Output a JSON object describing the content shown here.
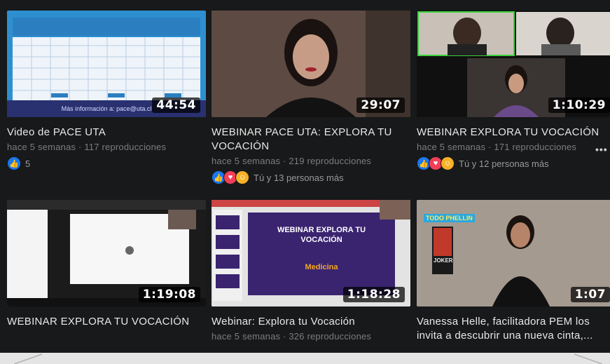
{
  "videos": [
    {
      "title": "Video de PACE UTA",
      "meta": "hace 5 semanas · 117 reproducciones",
      "duration": "44:54",
      "reaction_text": "5",
      "thumb_footer": "Más información a: pace@uta.cl"
    },
    {
      "title": "WEBINAR PACE UTA: EXPLORA TU VOCACIÓN",
      "meta": "hace 5 semanas · 219 reproducciones",
      "duration": "29:07",
      "reaction_text": "Tú y 13 personas más"
    },
    {
      "title": "WEBINAR EXPLORA TU VOCACIÓN",
      "meta": "hace 5 semanas · 171 reproducciones",
      "duration": "1:10:29",
      "reaction_text": "Tú y 12 personas más",
      "more": "•••"
    },
    {
      "title": "WEBINAR EXPLORA TU VOCACIÓN",
      "meta": "",
      "duration": "1:19:08"
    },
    {
      "title": "Webinar: Explora tu Vocación",
      "meta": "hace 5 semanas · 326 reproducciones",
      "duration": "1:18:28",
      "slide_title": "WEBINAR EXPLORA TU VOCACIÓN",
      "slide_subtitle": "Medicina"
    },
    {
      "title": "Vanessa Helle, facilitadora PEM los invita a descubrir una nueva cinta,...",
      "meta": "",
      "duration": "1:07",
      "poster_title": "JOKER",
      "sign_text": "TODO PHELLIN"
    }
  ],
  "colors": {
    "background": "#18191a",
    "like": "#1877f2",
    "love": "#f33e58",
    "care": "#f7b125"
  }
}
